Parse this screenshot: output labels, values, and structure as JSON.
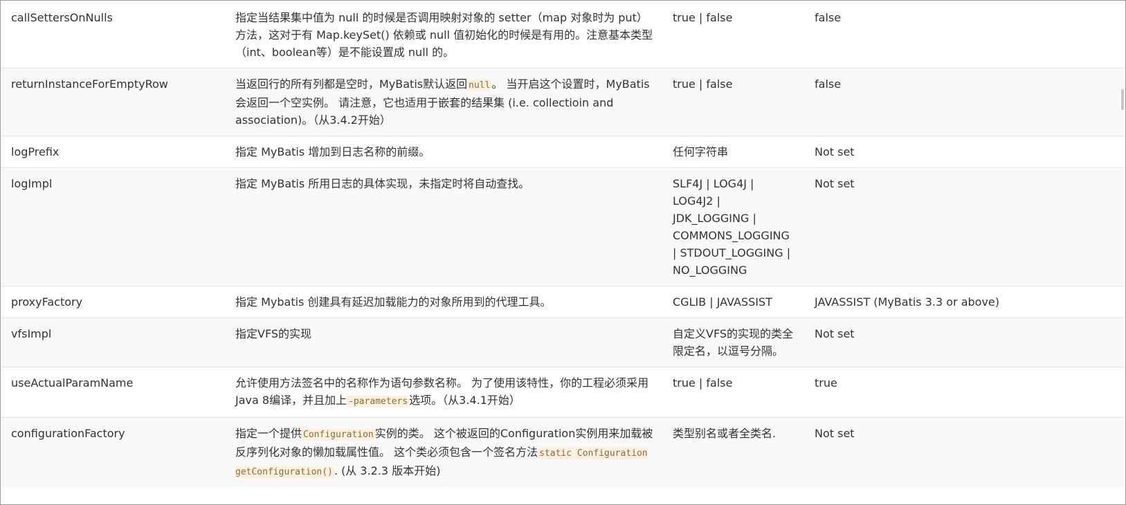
{
  "rows": [
    {
      "name": "callSettersOnNulls",
      "desc": [
        {
          "t": "指定当结果集中值为 null 的时候是否调用映射对象的 setter（map 对象时为 put）方法，这对于有 Map.keySet() 依赖或 null 值初始化的时候是有用的。注意基本类型（int、boolean等）是不能设置成 null 的。"
        }
      ],
      "values": "true | false",
      "default": "false"
    },
    {
      "name": "returnInstanceForEmptyRow",
      "desc": [
        {
          "t": "当返回行的所有列都是空时，MyBatis默认返回"
        },
        {
          "c": "null"
        },
        {
          "t": "。 当开启这个设置时，MyBatis会返回一个空实例。 请注意，它也适用于嵌套的结果集 (i.e. collectioin and association)。（从3.4.2开始）"
        }
      ],
      "values": "true | false",
      "default": "false"
    },
    {
      "name": "logPrefix",
      "desc": [
        {
          "t": "指定 MyBatis 增加到日志名称的前缀。"
        }
      ],
      "values": "任何字符串",
      "default": "Not set"
    },
    {
      "name": "logImpl",
      "desc": [
        {
          "t": "指定 MyBatis 所用日志的具体实现，未指定时将自动查找。"
        }
      ],
      "values": "SLF4J | LOG4J | LOG4J2 | JDK_LOGGING | COMMONS_LOGGING | STDOUT_LOGGING | NO_LOGGING",
      "default": "Not set"
    },
    {
      "name": "proxyFactory",
      "desc": [
        {
          "t": "指定 Mybatis 创建具有延迟加载能力的对象所用到的代理工具。"
        }
      ],
      "values": "CGLIB | JAVASSIST",
      "default": "JAVASSIST (MyBatis 3.3 or above)"
    },
    {
      "name": "vfsImpl",
      "desc": [
        {
          "t": "指定VFS的实现"
        }
      ],
      "values": "自定义VFS的实现的类全限定名，以逗号分隔。",
      "default": "Not set"
    },
    {
      "name": "useActualParamName",
      "desc": [
        {
          "t": "允许使用方法签名中的名称作为语句参数名称。 为了使用该特性，你的工程必须采用Java 8编译，并且加上"
        },
        {
          "c": "-parameters"
        },
        {
          "t": "选项。（从3.4.1开始）"
        }
      ],
      "values": "true | false",
      "default": "true"
    },
    {
      "name": "configurationFactory",
      "desc": [
        {
          "t": "指定一个提供"
        },
        {
          "c": "Configuration"
        },
        {
          "t": "实例的类。 这个被返回的Configuration实例用来加载被反序列化对象的懒加载属性值。 这个类必须包含一个签名方法"
        },
        {
          "c": "static Configuration getConfiguration()"
        },
        {
          "t": ". (从 3.2.3 版本开始)"
        }
      ],
      "values": "类型别名或者全类名.",
      "default": "Not set"
    }
  ]
}
